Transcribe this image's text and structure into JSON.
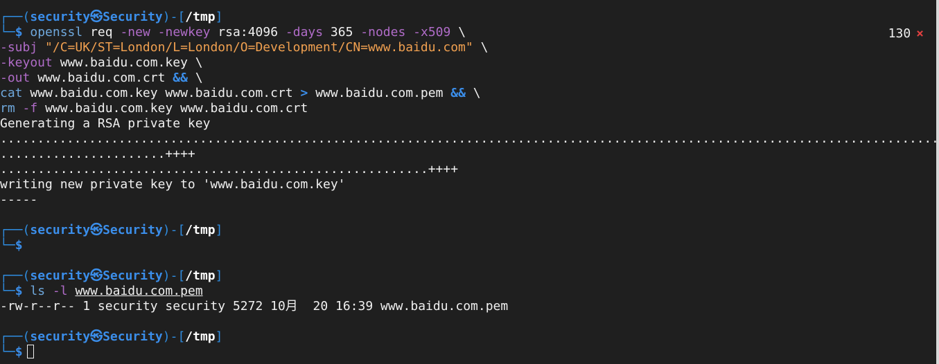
{
  "prompt": {
    "user": "security",
    "skull": "㉿",
    "host": "Security",
    "dir": "/tmp",
    "symbol": "$"
  },
  "exit_status": {
    "code": "130",
    "symbol": "×"
  },
  "block1": {
    "cmd": "openssl",
    "arg_req": "req",
    "flag_new": "-new",
    "flag_newkey": "-newkey",
    "arg_rsa": "rsa:4096",
    "flag_days": "-days",
    "arg_365": "365",
    "flag_nodes": "-nodes",
    "flag_x509": "-x509",
    "bs": "\\",
    "flag_subj": "-subj",
    "subj_str": "\"/C=UK/ST=London/L=London/O=Development/CN=www.baidu.com\"",
    "flag_keyout": "-keyout",
    "arg_keyfile": "www.baidu.com.key",
    "flag_out": "-out",
    "arg_crtfile": "www.baidu.com.crt",
    "op_and": "&&",
    "cmd_cat": "cat",
    "cat_args": "www.baidu.com.key www.baidu.com.crt",
    "redir": ">",
    "arg_pemfile": "www.baidu.com.pem",
    "cmd_rm": "rm",
    "flag_f": "-f",
    "rm_args": "www.baidu.com.key www.baidu.com.crt"
  },
  "output1": [
    "Generating a RSA private key",
    "...................................................................................................................................",
    "......................++++",
    ".........................................................++++",
    "writing new private key to 'www.baidu.com.key'",
    "-----"
  ],
  "block3": {
    "cmd": "ls",
    "flag": "-l",
    "arg": "www.baidu.com.pem"
  },
  "output3": "-rw-r--r-- 1 security security 5272 10月  20 16:39 www.baidu.com.pem"
}
